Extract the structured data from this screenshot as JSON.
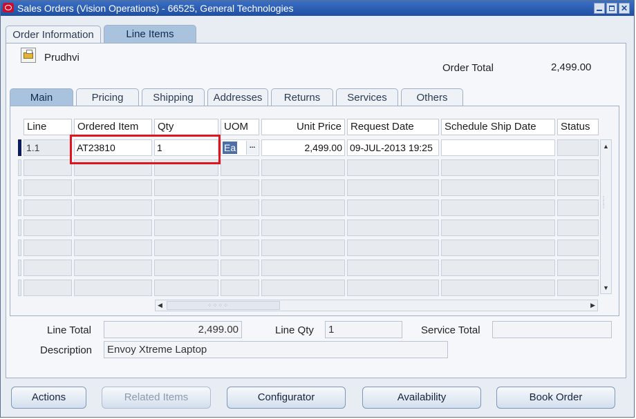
{
  "window": {
    "title": "Sales Orders (Vision Operations) - 66525, General Technologies"
  },
  "top_tabs": [
    {
      "label": "Order Information"
    },
    {
      "label": "Line Items"
    }
  ],
  "header": {
    "customer_name": "Prudhvi",
    "order_total_label": "Order Total",
    "order_total_value": "2,499.00"
  },
  "sub_tabs": [
    {
      "label": "Main"
    },
    {
      "label": "Pricing"
    },
    {
      "label": "Shipping"
    },
    {
      "label": "Addresses"
    },
    {
      "label": "Returns"
    },
    {
      "label": "Services"
    },
    {
      "label": "Others"
    }
  ],
  "table": {
    "columns": [
      "Line",
      "Ordered Item",
      "Qty",
      "UOM",
      "Unit Price",
      "Request Date",
      "Schedule Ship Date",
      "Status"
    ],
    "row1": {
      "line": "1.1",
      "ordered_item": "AT23810",
      "qty": "1",
      "uom": "Ea",
      "unit_price": "2,499.00",
      "request_date": "09-JUL-2013 19:25",
      "schedule_ship_date": "",
      "status": ""
    },
    "uom_lov_glyph": "...",
    "highlight_color": "#e0141c"
  },
  "footer": {
    "line_total_label": "Line Total",
    "line_total_value": "2,499.00",
    "line_qty_label": "Line Qty",
    "line_qty_value": "1",
    "service_total_label": "Service Total",
    "service_total_value": "",
    "description_label": "Description",
    "description_value": "Envoy Xtreme Laptop"
  },
  "buttons": {
    "actions": "Actions",
    "related_items": "Related Items",
    "configurator": "Configurator",
    "availability": "Availability",
    "book_order": "Book Order"
  }
}
